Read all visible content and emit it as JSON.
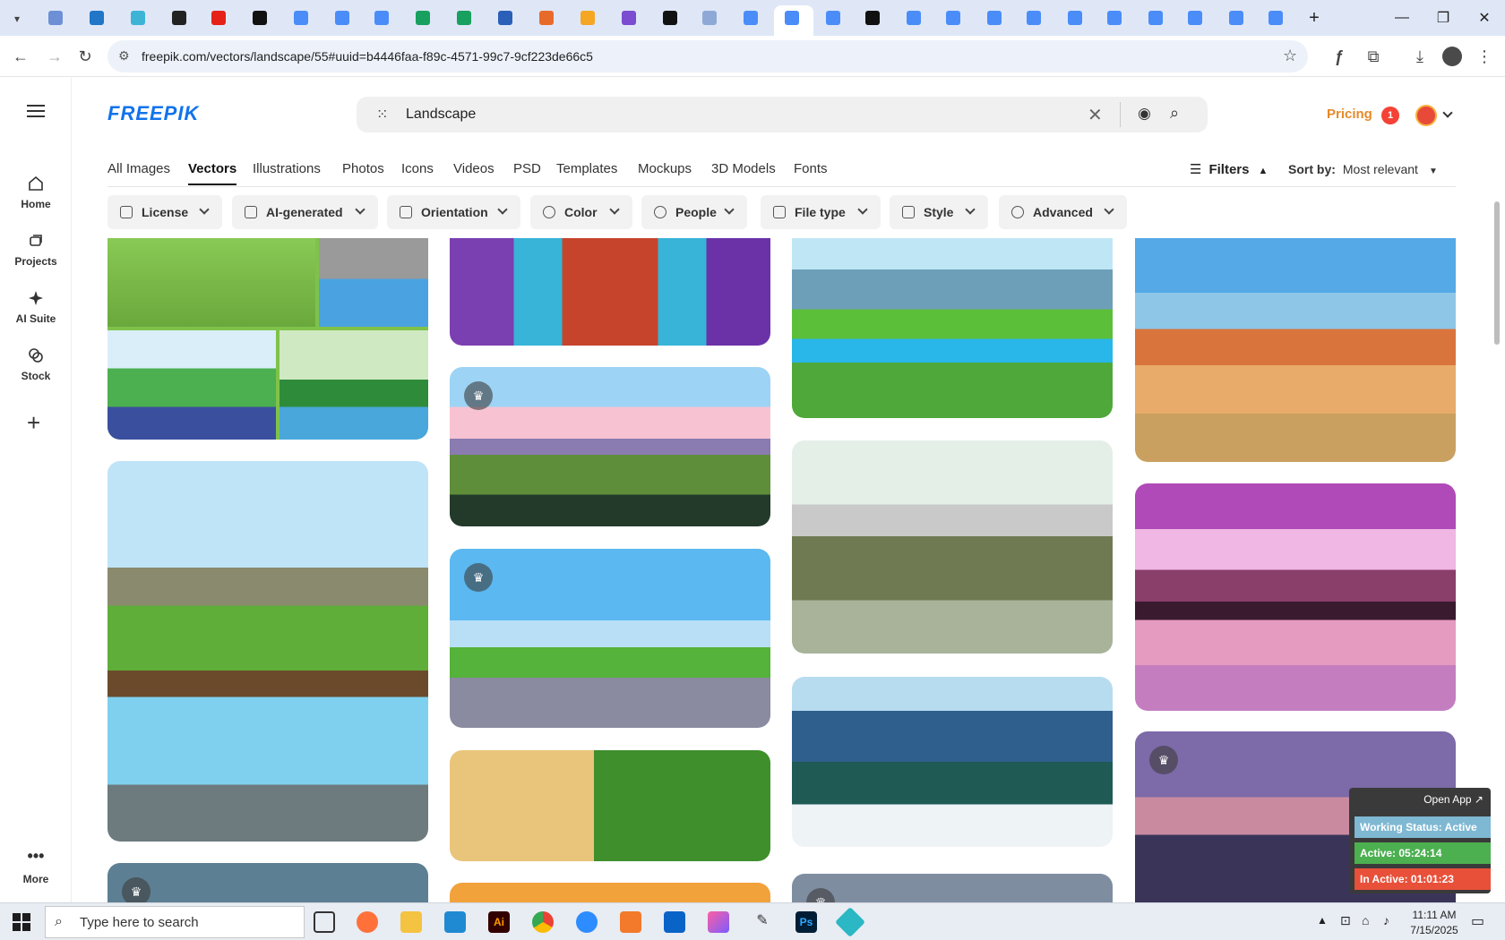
{
  "browser": {
    "url": "freepik.com/vectors/landscape/55#uuid=b4446faa-f89c-4571-99c7-9cf223de66c5",
    "tab_favicons": [
      "#6d8fd6",
      "#2176c7",
      "#3db4d6",
      "#222",
      "#e62117",
      "#111",
      "#4b8df8",
      "#4b8df8",
      "#4b8df8",
      "#18a05e",
      "#18a05e",
      "#2b5fb8",
      "#e86a2a",
      "#f5a623",
      "#7b4ccf",
      "#111",
      "#8fa9d6",
      "#4b8df8",
      "#4b8df8",
      "#4b8df8",
      "#111",
      "#4b8df8",
      "#4b8df8",
      "#4b8df8",
      "#4b8df8",
      "#4b8df8",
      "#4b8df8",
      "#4b8df8",
      "#4b8df8",
      "#4b8df8",
      "#4b8df8"
    ]
  },
  "sidebar": {
    "items": [
      {
        "label": "Home",
        "icon": "home-icon"
      },
      {
        "label": "Projects",
        "icon": "projects-icon"
      },
      {
        "label": "AI Suite",
        "icon": "sparkle-icon"
      },
      {
        "label": "Stock",
        "icon": "stock-icon"
      }
    ],
    "more_label": "More"
  },
  "header": {
    "logo": "FREEPIK",
    "search_value": "Landscape",
    "pricing": "Pricing",
    "notification_count": "1"
  },
  "nav_tabs": [
    "All Images",
    "Vectors",
    "Illustrations",
    "Photos",
    "Icons",
    "Videos",
    "PSD",
    "Templates",
    "Mockups",
    "3D Models",
    "Fonts"
  ],
  "active_tab": "Vectors",
  "filters_label": "Filters",
  "sort": {
    "label": "Sort by:",
    "value": "Most relevant"
  },
  "filter_chips": [
    "License",
    "AI-generated",
    "Orientation",
    "Color",
    "People",
    "File type",
    "Style",
    "Advanced"
  ],
  "widget": {
    "open_app": "Open App ↗",
    "status": "Working Status: Active",
    "active": "Active: 05:24:14",
    "inactive": "In Active: 01:01:23"
  },
  "taskbar": {
    "search_placeholder": "Type here to search",
    "time": "11:11 AM",
    "date": "7/15/2025"
  }
}
